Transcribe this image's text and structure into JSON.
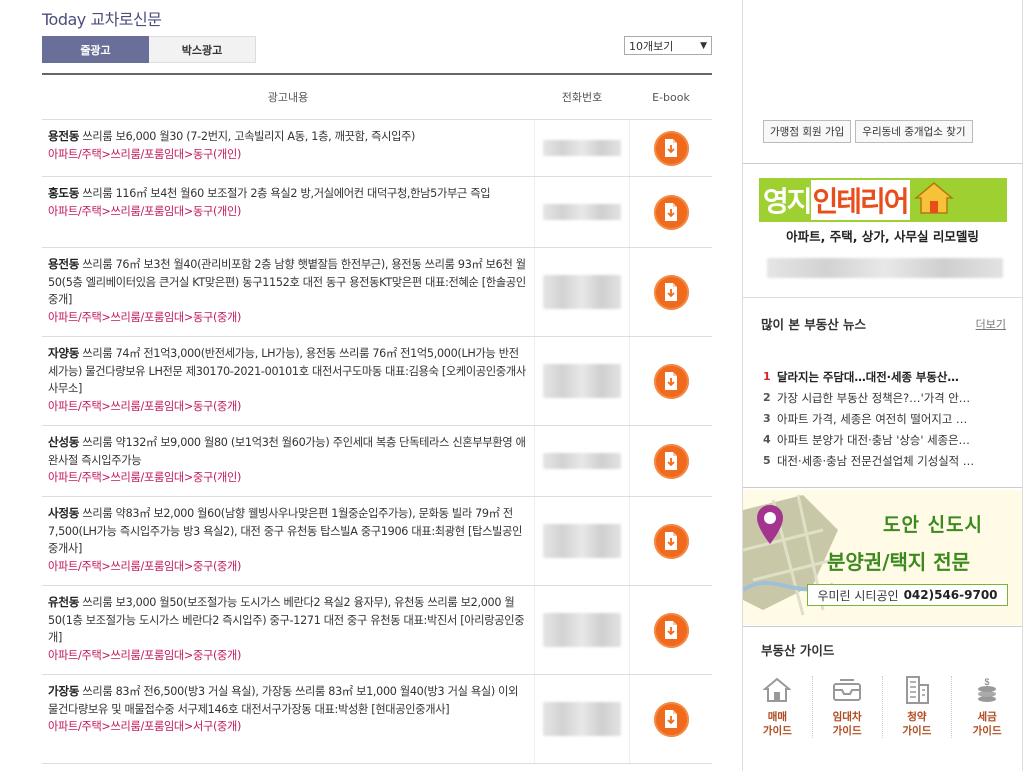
{
  "header": {
    "title": "Today 교차로신문",
    "tabs": [
      {
        "label": "줄광고",
        "active": true
      },
      {
        "label": "박스광고",
        "active": false
      }
    ],
    "page_size_select": "10개보기"
  },
  "table": {
    "columns": [
      "광고내용",
      "전화번호",
      "E-book"
    ],
    "rows": [
      {
        "location": "용전동",
        "text": " 쓰리룸 보6,000 월30 (7-2번지, 고속빌리지 A동, 1층, 깨끗함, 즉시입주)",
        "category": "아파트/주택>쓰리룸/포룸임대>동구(개인)"
      },
      {
        "location": "홍도동",
        "text": " 쓰리룸 116㎡ 보4천 월60 보조절가 2층 욕실2 방,거실에어컨 대덕구청,한남5가부근 즉입",
        "category": "아파트/주택>쓰리룸/포룸임대>동구(개인)"
      },
      {
        "location": "용전동",
        "text": " 쓰리룸 76㎡ 보3천 월40(관리비포함 2층 남향 햇볕잘듬 한전부근), 용전동 쓰리룸 93㎡ 보6천 월50(5층 엘리베이터있음 큰거실 KT맞은편) 동구1152호 대전 동구 용전동KT맞은편 대표:전혜순 [한솔공인중개]",
        "category": "아파트/주택>쓰리룸/포룸임대>동구(중개)"
      },
      {
        "location": "자양동",
        "text": " 쓰리룸 74㎡ 전1억3,000(반전세가능, LH가능), 용전동 쓰리룸 76㎡ 전1억5,000(LH가능 반전세가능) 물건다량보유 LH전문 제30170-2021-00101호 대전서구도마동 대표:김용숙 [오케이공인중개사사무소]",
        "category": "아파트/주택>쓰리룸/포룸임대>동구(중개)"
      },
      {
        "location": "산성동",
        "text": " 쓰리룸 약132㎡ 보9,000 월80 (보1억3천 월60가능) 주인세대 복층 단독테라스 신혼부부환영 애완사절 즉시입주가능",
        "category": "아파트/주택>쓰리룸/포룸임대>중구(개인)"
      },
      {
        "location": "사정동",
        "text": " 쓰리룸 약83㎡ 보2,000 월60(남향 웰빙사우나맞은편 1월중순입주가능), 문화동 빌라 79㎡ 전7,500(LH가능 즉시입주가능 방3 욕실2), 대전 중구 유천동 탑스빌A 중구1906 대표:최광현 [탑스빌공인중개사]",
        "category": "아파트/주택>쓰리룸/포룸임대>중구(중개)"
      },
      {
        "location": "유천동",
        "text": " 쓰리룸 보3,000 월50(보조절가능 도시가스 베란다2 욕실2 융자무), 유천동 쓰리룸 보2,000 월50(1층 보조절가능 도시가스 베란다2 즉시입주) 중구-1271 대전 중구 유천동 대표:박진서 [아리랑공인중개]",
        "category": "아파트/주택>쓰리룸/포룸임대>중구(중개)"
      },
      {
        "location": "가장동",
        "text": " 쓰리룸 83㎡ 전6,500(방3 거실 욕실), 가장동 쓰리룸 83㎡ 보1,000 월40(방3 거실 욕실) 이외 물건다량보유 및 매물접수중 서구제146호 대전서구가장동 대표:박성환 [현대공인중개사]",
        "category": "아파트/주택>쓰리룸/포룸임대>서구(중개)"
      }
    ]
  },
  "sidebar": {
    "buttons": [
      "가맹점 회원 가입",
      "우리동네 중개업소 찾기"
    ],
    "banner1": {
      "title_part1": "영지",
      "title_part2": "인테리어",
      "subtitle": "아파트, 주택, 상가, 사무실 리모델링"
    },
    "news": {
      "title": "많이 본 부동산 뉴스",
      "more": "더보기",
      "items": [
        {
          "num": "1",
          "text": "달라지는 주담대…대전·세종 부동산…"
        },
        {
          "num": "2",
          "text": "가장 시급한 부동산 정책은?…'가격 안…"
        },
        {
          "num": "3",
          "text": "아파트 가격, 세종은 여전히 떨어지고 …"
        },
        {
          "num": "4",
          "text": "아파트 분양가 대전·충남 '상승' 세종은…"
        },
        {
          "num": "5",
          "text": "대전·세종·충남 전문건설업체 기성실적 …"
        }
      ]
    },
    "banner2": {
      "line1": "도안 신도시",
      "line2": "분양권/택지 전문",
      "contact_name": "우미린 시티공인",
      "contact_phone": "042)546-9700"
    },
    "guide": {
      "title": "부동산 가이드",
      "items": [
        {
          "label1": "매매",
          "label2": "가이드",
          "icon": "house-icon"
        },
        {
          "label1": "임대차",
          "label2": "가이드",
          "icon": "inbox-icon"
        },
        {
          "label1": "청약",
          "label2": "가이드",
          "icon": "building-icon"
        },
        {
          "label1": "세금",
          "label2": "가이드",
          "icon": "coins-icon"
        }
      ]
    }
  },
  "colors": {
    "accent": "#6a6f9a",
    "category_text": "#c2185b",
    "ebook_button": "#ef6a1c",
    "news_highlight": "#d8232a"
  }
}
